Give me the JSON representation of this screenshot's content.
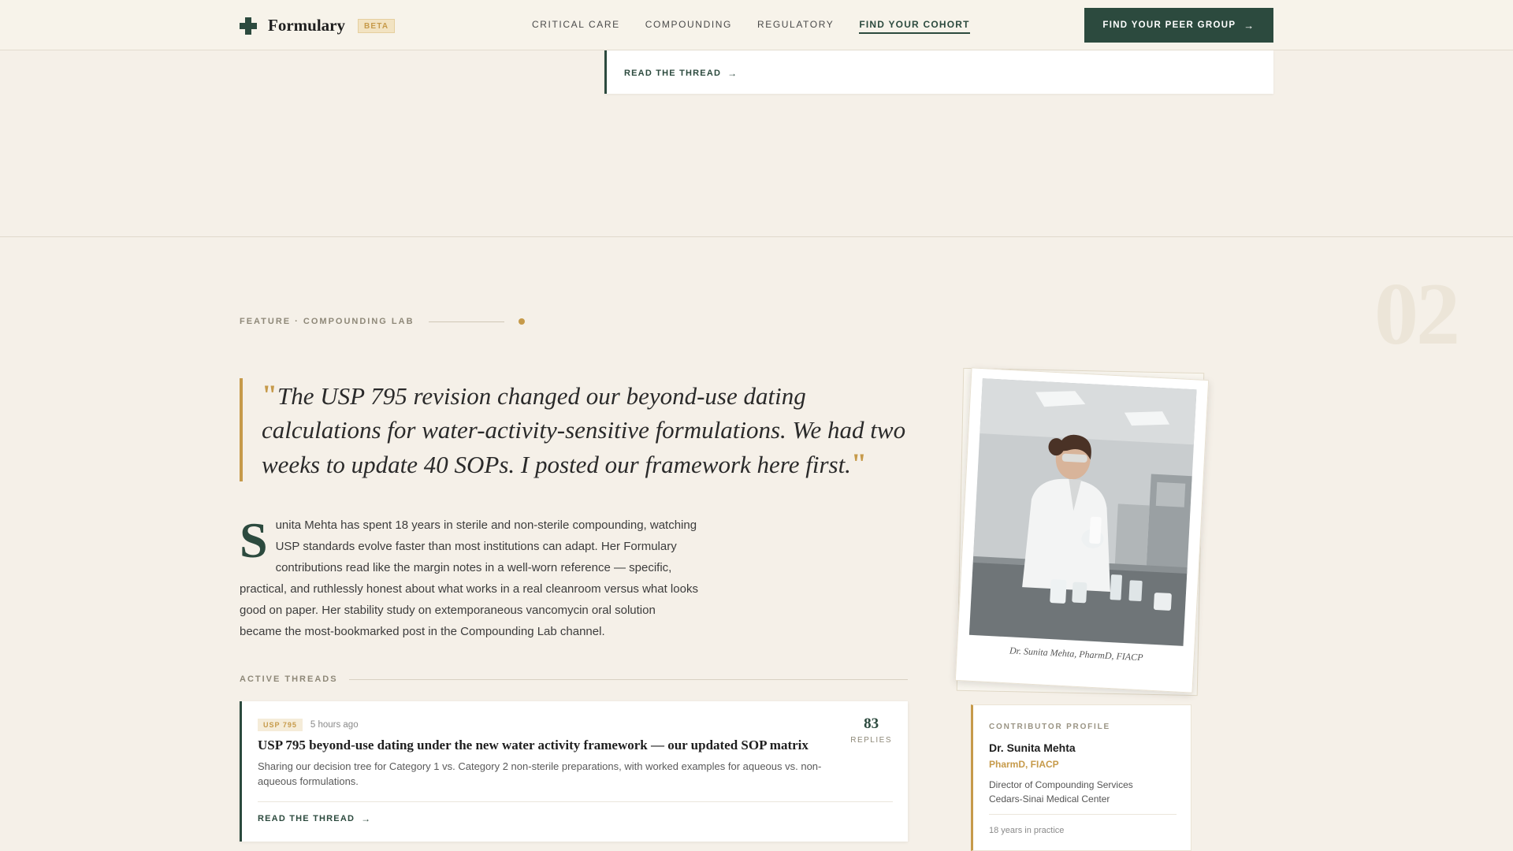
{
  "header": {
    "brand": "Formulary",
    "badge": "BETA",
    "nav": [
      "CRITICAL CARE",
      "COMPOUNDING",
      "REGULATORY",
      "FIND YOUR COHORT"
    ],
    "active_nav": "FIND YOUR COHORT",
    "cta_label": "FIND YOUR PEER GROUP"
  },
  "top_card": {
    "read_label": "READ THE THREAD"
  },
  "feature": {
    "number": "02",
    "eyebrow": "FEATURE · COMPOUNDING LAB",
    "quote": "The USP 795 revision changed our beyond-use dating calculations for water-activity-sensitive formulations. We had two weeks to update 40 SOPs. I posted our framework here first.",
    "dropcap": "S",
    "bio": "unita Mehta has spent 18 years in sterile and non-sterile compounding, watching USP standards evolve faster than most institutions can adapt. Her Formulary contributions read like the margin notes in a well-worn reference — specific, practical, and ruthlessly honest about what works in a real cleanroom versus what looks good on paper. Her stability study on extemporaneous vancomycin oral solution became the most-bookmarked post in the Compounding Lab channel."
  },
  "threads": {
    "label": "ACTIVE THREADS",
    "items": [
      {
        "tag": "USP 795",
        "time": "5 hours ago",
        "title": "USP 795 beyond-use dating under the new water activity framework — our updated SOP matrix",
        "excerpt": "Sharing our decision tree for Category 1 vs. Category 2 non-sterile preparations, with worked examples for aqueous vs. non-aqueous formulations.",
        "replies": "83",
        "replies_label": "REPLIES",
        "read_label": "READ THE THREAD"
      }
    ]
  },
  "photo": {
    "caption": "Dr. Sunita Mehta, PharmD, FIACP"
  },
  "profile": {
    "label": "CONTRIBUTOR PROFILE",
    "name": "Dr. Sunita Mehta",
    "credentials": "PharmD, FIACP",
    "role": "Director of Compounding Services",
    "org": "Cedars-Sinai Medical Center",
    "years": "18 years in practice"
  },
  "colors": {
    "background": "#f5f0e8",
    "primary": "#2c4a3e",
    "accent": "#c69a4a"
  }
}
